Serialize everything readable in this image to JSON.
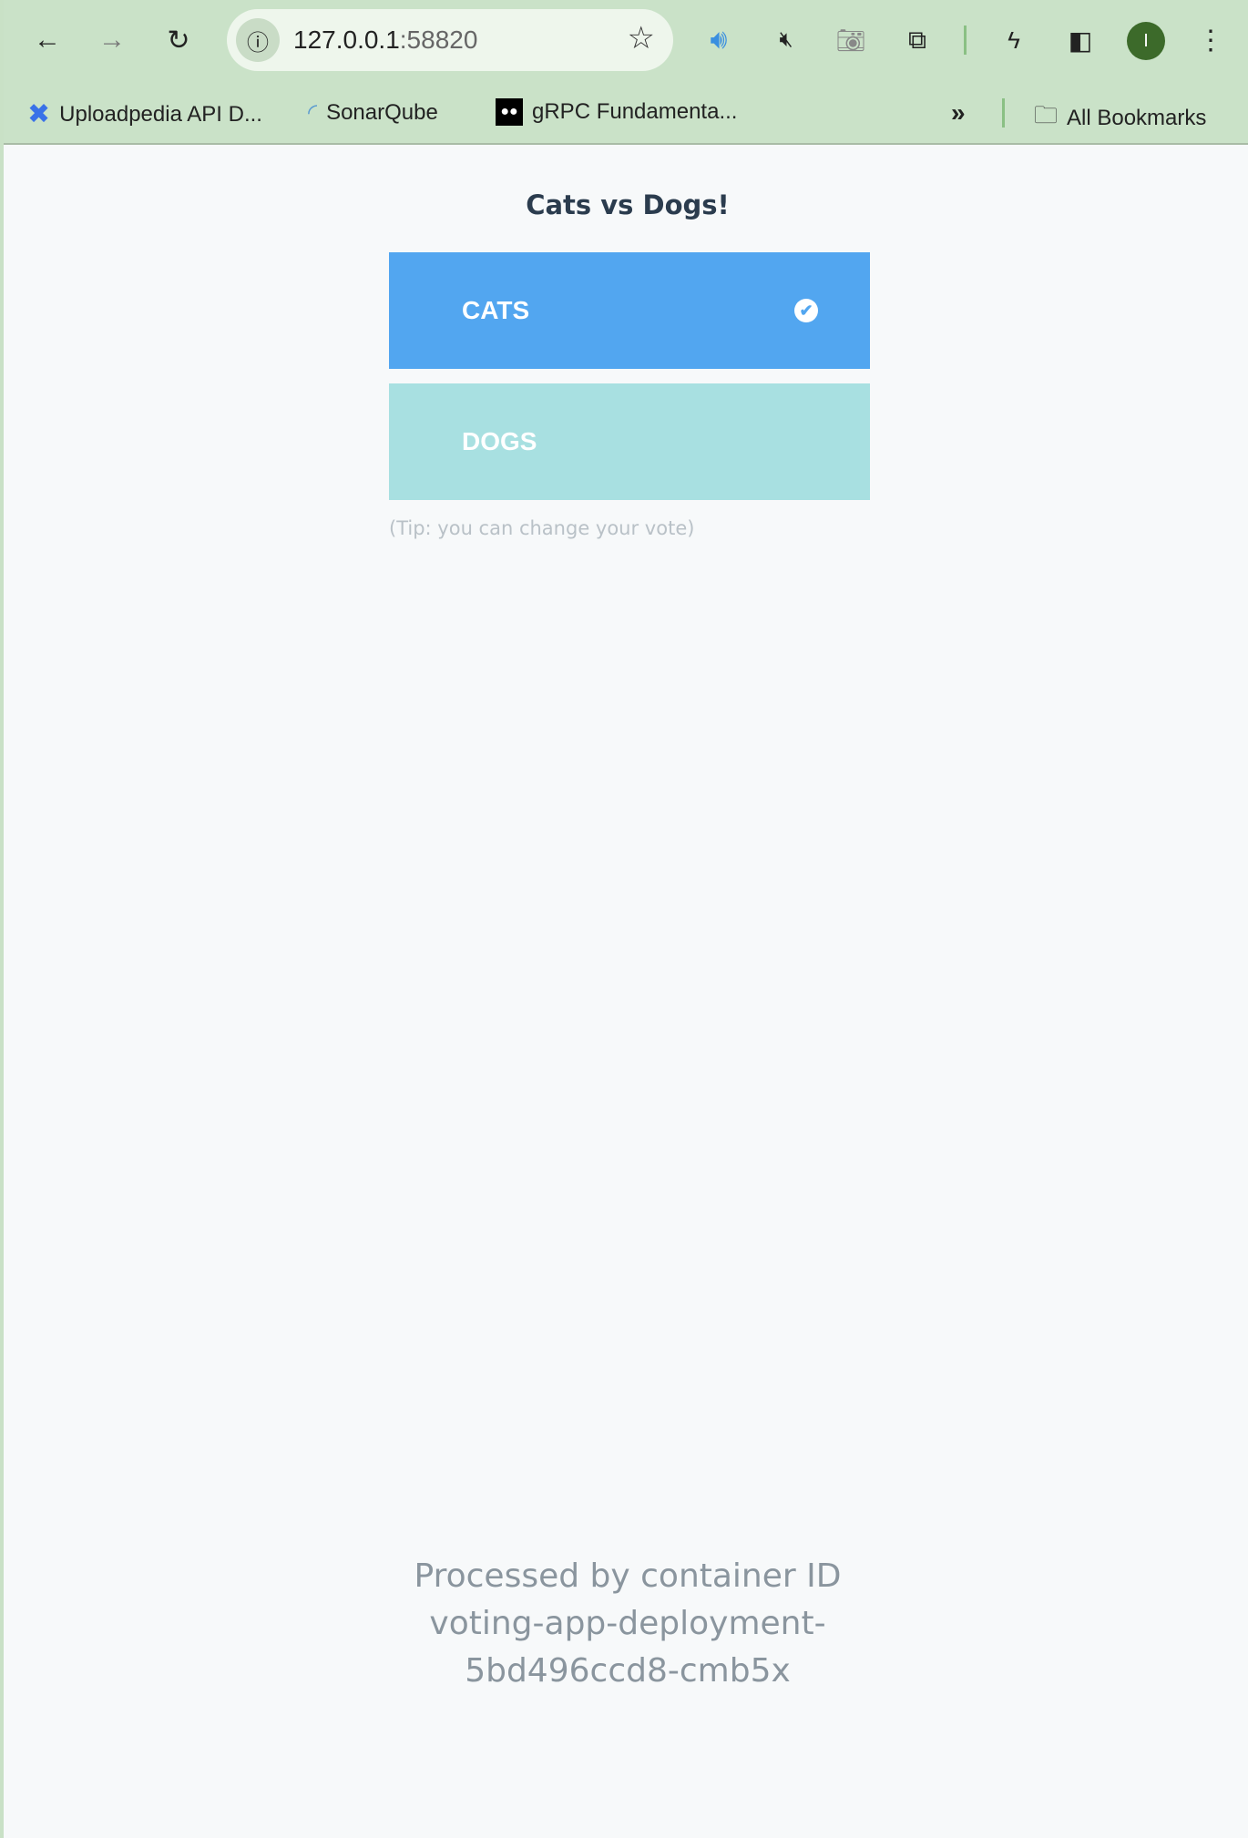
{
  "browser": {
    "url_host": "127.0.0.1",
    "url_port": ":58820",
    "avatar_initial": "I",
    "bookmarks": [
      {
        "label": "Uploadpedia API D..."
      },
      {
        "label": "SonarQube"
      },
      {
        "label": "gRPC Fundamenta..."
      }
    ],
    "all_bookmarks": "All Bookmarks"
  },
  "page": {
    "title": "Cats vs Dogs!",
    "options": [
      {
        "label": "CATS",
        "selected": true,
        "color": "#52a6f0"
      },
      {
        "label": "DOGS",
        "selected": false,
        "color": "#a8e0e1"
      }
    ],
    "tip": "(Tip: you can change your vote)",
    "footer_lines": [
      "Processed by container ID",
      "voting-app-deployment-",
      "5bd496ccd8-cmb5x"
    ]
  }
}
